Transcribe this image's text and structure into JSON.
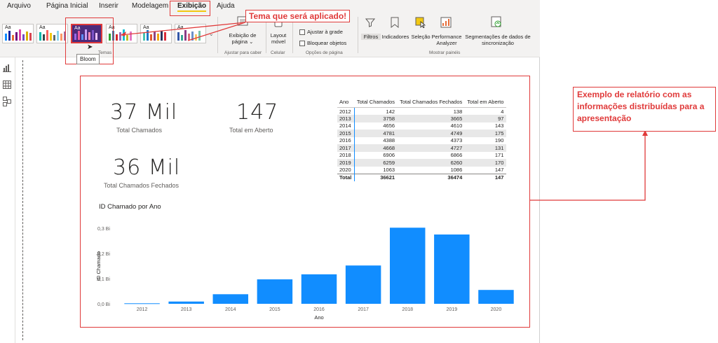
{
  "menu": [
    "Arquivo",
    "Página Inicial",
    "Inserir",
    "Modelagem",
    "Exibição",
    "Ajuda"
  ],
  "ribbon": {
    "themes_label": "Temas",
    "tooltip": "Bloom",
    "page_view": "Exibição de página",
    "page_view_arrow": "⌄",
    "fit_group": "Ajustar para caber",
    "mobile_layout": "Layout móvel",
    "cell_group": "Celular",
    "snap_grid": "Ajustar à grade",
    "lock_objects": "Bloquear objetos",
    "page_options": "Opções de página",
    "filters": "Filtros",
    "bookmarks": "Indicadores",
    "selection": "Seleção",
    "performance": "Performance Analyzer",
    "sync_slicers": "Segmentações de dados de sincronização",
    "show_panes": "Mostrar painéis"
  },
  "annotations": {
    "theme_callout": "Tema que será aplicado!",
    "report_callout": "Exemplo de relatório com as informações distribuídas para a apresentação"
  },
  "cards": [
    {
      "value": "37 Mil",
      "label": "Total Chamados"
    },
    {
      "value": "147",
      "label": "Total em Aberto"
    },
    {
      "value": "36 Mil",
      "label": "Total Chamados Fechados"
    }
  ],
  "table": {
    "headers": [
      "Ano",
      "Total Chamados",
      "Total Chamados Fechados",
      "Total em Aberto"
    ],
    "rows": [
      [
        "2012",
        "142",
        "138",
        "4"
      ],
      [
        "2013",
        "3758",
        "3665",
        "97"
      ],
      [
        "2014",
        "4656",
        "4610",
        "143"
      ],
      [
        "2015",
        "4781",
        "4749",
        "175"
      ],
      [
        "2016",
        "4388",
        "4373",
        "190"
      ],
      [
        "2017",
        "4668",
        "4727",
        "131"
      ],
      [
        "2018",
        "6906",
        "6866",
        "171"
      ],
      [
        "2019",
        "6259",
        "6260",
        "170"
      ],
      [
        "2020",
        "1063",
        "1086",
        "147"
      ]
    ],
    "total": [
      "Total",
      "36621",
      "36474",
      "147"
    ]
  },
  "chart_data": {
    "type": "bar",
    "title": "ID Chamado por Ano",
    "xlabel": "Ano",
    "ylabel": "ID Chamado",
    "categories": [
      "2012",
      "2013",
      "2014",
      "2015",
      "2016",
      "2017",
      "2018",
      "2019",
      "2020"
    ],
    "values": [
      0.002,
      0.009,
      0.038,
      0.097,
      0.117,
      0.152,
      0.302,
      0.275,
      0.055
    ],
    "ylim": [
      0,
      0.3
    ],
    "yticks": [
      "0,0 Bi",
      "0,1 Bi",
      "0,2 Bi",
      "0,3 Bi"
    ],
    "grid": false,
    "color": "#118dff"
  },
  "colors": {
    "accent": "#118dff",
    "annotation": "#e03a3a",
    "ribbon_bg": "#f3f2f1"
  }
}
